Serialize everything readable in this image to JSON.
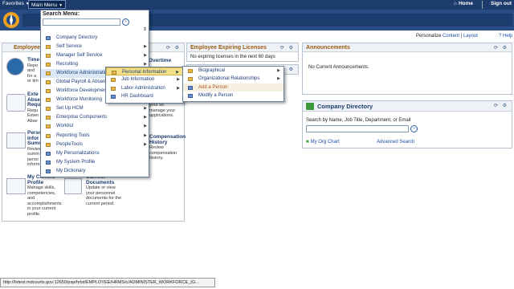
{
  "topbar": {
    "favorites": "Favorites",
    "main_menu": "Main Menu",
    "home": "Home",
    "sign_out": "Sign out"
  },
  "personalize": {
    "label": "Personalize",
    "content": "Content",
    "sep": "|",
    "layout": "Layout",
    "help": "Help"
  },
  "main_menu": {
    "title": "Search Menu:",
    "search_value": "",
    "items": [
      {
        "label": "Company Directory",
        "icon": "page-icon",
        "has_sub": false
      },
      {
        "label": "Self Service",
        "icon": "folder-icon",
        "has_sub": true
      },
      {
        "label": "Manager Self Service",
        "icon": "folder-icon",
        "has_sub": true
      },
      {
        "label": "Recruiting",
        "icon": "folder-icon",
        "has_sub": true
      },
      {
        "label": "Workforce Administration",
        "icon": "folder-icon",
        "has_sub": true
      },
      {
        "label": "Global Payroll & Absence Mgmt",
        "icon": "folder-icon",
        "has_sub": true
      },
      {
        "label": "Workforce Development",
        "icon": "folder-icon",
        "has_sub": true
      },
      {
        "label": "Workforce Monitoring",
        "icon": "folder-icon",
        "has_sub": true
      },
      {
        "label": "Set Up HCM",
        "icon": "folder-icon",
        "has_sub": true
      },
      {
        "label": "Enterprise Components",
        "icon": "folder-icon",
        "has_sub": true
      },
      {
        "label": "Worklist",
        "icon": "folder-icon",
        "has_sub": true
      },
      {
        "label": "Reporting Tools",
        "icon": "folder-icon",
        "has_sub": true
      },
      {
        "label": "PeopleTools",
        "icon": "folder-icon",
        "has_sub": true
      },
      {
        "label": "My Personalizations",
        "icon": "page-icon",
        "has_sub": false
      },
      {
        "label": "My System Profile",
        "icon": "page-icon",
        "has_sub": false
      },
      {
        "label": "My Dictionary",
        "icon": "page-icon",
        "has_sub": false
      }
    ]
  },
  "submenu1": {
    "items": [
      {
        "label": "Personal Information",
        "icon": "folder-icon",
        "has_sub": true
      },
      {
        "label": "Job Information",
        "icon": "folder-icon",
        "has_sub": true
      },
      {
        "label": "Labor Administration",
        "icon": "folder-icon",
        "has_sub": true
      },
      {
        "label": "HR Dashboard",
        "icon": "page-icon",
        "has_sub": false
      }
    ]
  },
  "submenu2": {
    "items": [
      {
        "label": "Biographical",
        "icon": "folder-icon",
        "has_sub": true
      },
      {
        "label": "Organizational Relationships",
        "icon": "folder-icon",
        "has_sub": true
      },
      {
        "label": "Add a Person",
        "icon": "page-icon",
        "has_sub": false
      },
      {
        "label": "Modify a Person",
        "icon": "page-icon",
        "has_sub": false
      }
    ]
  },
  "pagelets": {
    "employee_title": "Employee",
    "licenses_title": "Employee Expiring Licenses",
    "licenses_body": "No expiring licenses in the next 60 days",
    "announcements_title": "Announcements",
    "announcements_body": "No Current Announcements.",
    "directory_title": "Company Directory",
    "directory_search_label": "Search by Name, Job Title, Department, or Email",
    "directory_org_chart": "My Org Chart",
    "directory_advanced": "Advanced Search"
  },
  "tiles": {
    "time_title": "Time",
    "time_desc": "Repo\nand\nfor a\nor tim",
    "overtime_title": "Overtime",
    "absence_title": "Exte\nAbse\nRequ",
    "absence_desc": "Requ\nExten\nAbse",
    "manage_desc": "your so\nmanage your\napplications.",
    "personal_title": "Perso\nInfor\nSumm",
    "personal_desc": "Review\nsumm\nperso\ninform",
    "compensation_title": "Compensation\nHistory",
    "compensation_desc": "Review\ncompensation\nhistory.",
    "profile_title": "My Current\nProfile",
    "profile_desc": "Manage skills,\ncompetencies,\nand\naccomplishments\nin your current\nprofile.",
    "documents_title": "Current\nDocuments",
    "documents_desc": "Update or view\nyour personnel\ndocuments for the\ncurrent period."
  },
  "status_bar": "http://hrtest.mdcourts.gov:12650/psp/hrtst/EMPLOYEE/HRMS/c/ADMINISTER_WORKFORCE_(G..."
}
